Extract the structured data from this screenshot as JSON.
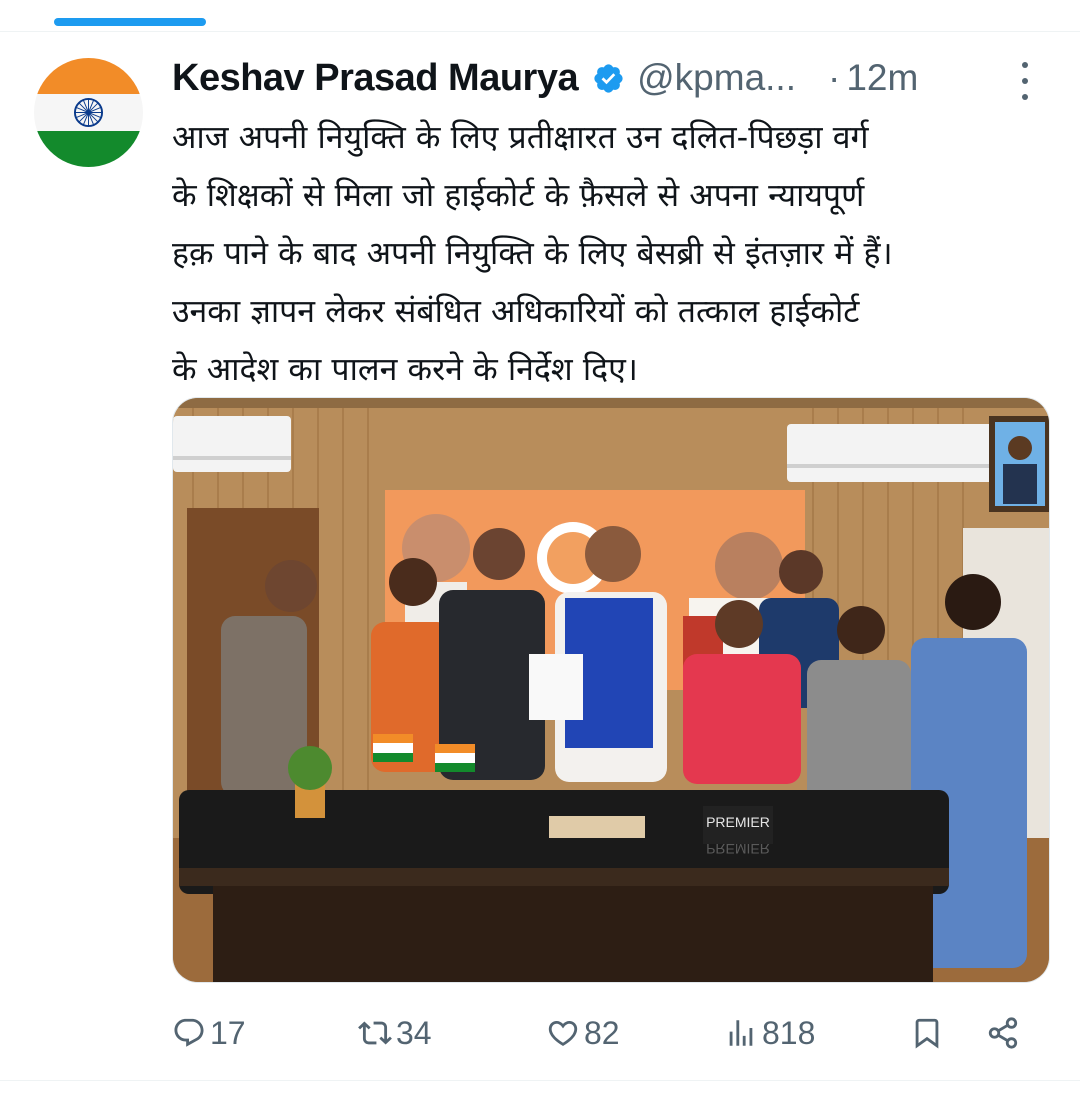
{
  "tweet": {
    "author_name": "Keshav Prasad Maurya",
    "handle": "@kpma...",
    "separator": "·",
    "time": "12m",
    "text_lines": [
      "आज अपनी नियुक्ति के लिए प्रतीक्षारत उन दलित-पिछड़ा वर्ग",
      "के शिक्षकों से मिला जो हाईकोर्ट के फ़ैसले से अपना न्यायपूर्ण",
      "हक़ पाने के बाद अपनी नियुक्ति के लिए बेसब्री से इंतज़ार में हैं।",
      "उनका ज्ञापन लेकर संबंधित अधिकारियों को तत्काल हाईकोर्ट",
      "के आदेश का पालन करने के निर्देश दिए।"
    ],
    "media": {
      "desk_plate": "PREMIER",
      "desk_plate_reflection": "PREMIER"
    }
  },
  "actions": {
    "replies": "17",
    "reposts": "34",
    "likes": "82",
    "views": "818"
  },
  "icons": {
    "verified": "verified-badge-icon",
    "more": "more-vertical-icon",
    "reply": "reply-icon",
    "repost": "repost-icon",
    "like": "heart-icon",
    "views": "views-icon",
    "bookmark": "bookmark-icon",
    "share": "share-icon"
  },
  "colors": {
    "accent": "#1d9bf0",
    "secondary_text": "#536471",
    "primary_text": "#0f1419"
  }
}
